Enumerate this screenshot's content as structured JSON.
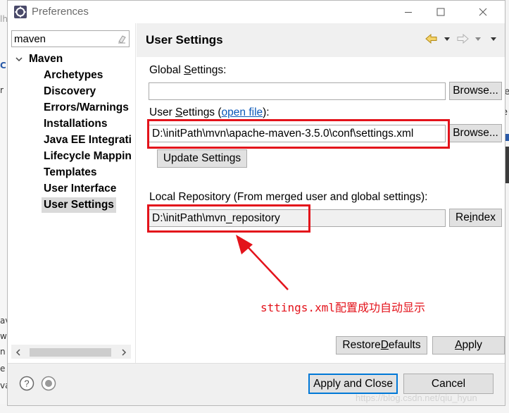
{
  "window": {
    "title": "Preferences"
  },
  "filter": {
    "value": "maven"
  },
  "tree": {
    "root": "Maven",
    "items": [
      "Archetypes",
      "Discovery",
      "Errors/Warnings",
      "Installations",
      "Java EE Integrati",
      "Lifecycle Mappin",
      "Templates",
      "User Interface",
      "User Settings"
    ],
    "selected_index": 8
  },
  "page": {
    "title": "User Settings"
  },
  "global_settings": {
    "label_pre": "Global ",
    "label_mnemonic": "S",
    "label_post": "ettings:",
    "value": "",
    "browse_label": "Browse..."
  },
  "user_settings": {
    "label_pre": "User ",
    "label_mnemonic": "S",
    "label_post": "ettings (",
    "link_text": "open file",
    "label_end": "):",
    "value": "D:\\initPath\\mvn\\apache-maven-3.5.0\\conf\\settings.xml",
    "browse_label": "Browse...",
    "update_label": "Update Settings"
  },
  "local_repository": {
    "label": "Local Repository (From merged user and global settings):",
    "value": "D:\\initPath\\mvn_repository",
    "reindex_pre": "Re",
    "reindex_mnemonic": "i",
    "reindex_post": "ndex"
  },
  "annotation": {
    "text": "sttings.xml配置成功自动显示",
    "color": "#e3131b"
  },
  "buttons": {
    "restore_pre": "Restore ",
    "restore_mnemonic": "D",
    "restore_post": "efaults",
    "apply_pre": "",
    "apply_mnemonic": "A",
    "apply_post": "pply",
    "apply_close": "Apply and Close",
    "cancel": "Cancel"
  },
  "watermark": "https://blog.csdn.net/qiu_hyun",
  "background_fragments": [
    "lh",
    "C",
    "r",
    "av",
    "w",
    "n",
    "e",
    "va",
    "he",
    "re"
  ],
  "colors": {
    "highlight": "#e3131b",
    "link": "#0a58b8",
    "selected_bg": "#dadada",
    "default_button_border": "#0078d7"
  },
  "icons": {
    "window": "eclipse-preferences-icon",
    "minimize": "minimize-icon",
    "maximize": "maximize-icon",
    "close": "close-icon",
    "filter_clear": "eraser-icon",
    "tree_expand": "chevron-down-icon",
    "back": "back-arrow-icon",
    "forward": "forward-arrow-icon",
    "help": "help-icon",
    "preferences_io": "import-export-icon"
  }
}
